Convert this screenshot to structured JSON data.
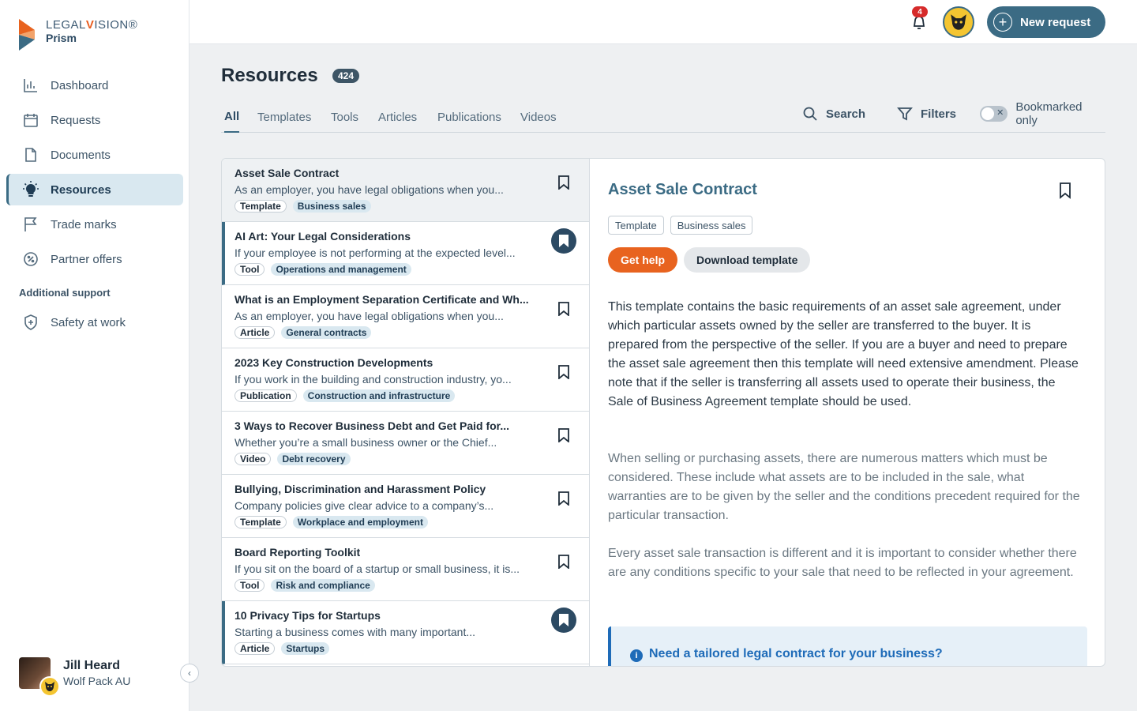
{
  "brand": {
    "name_prefix": "LEGAL",
    "name_highlight": "V",
    "name_suffix": "ISION",
    "product": "Prism"
  },
  "sidebar": {
    "items": [
      {
        "label": "Dashboard",
        "icon": "bar-chart-icon"
      },
      {
        "label": "Requests",
        "icon": "calendar-icon"
      },
      {
        "label": "Documents",
        "icon": "document-icon"
      },
      {
        "label": "Resources",
        "icon": "lightbulb-icon",
        "active": true
      },
      {
        "label": "Trade marks",
        "icon": "flag-icon"
      },
      {
        "label": "Partner offers",
        "icon": "percent-badge-icon"
      }
    ],
    "section_label": "Additional support",
    "support_items": [
      {
        "label": "Safety at work",
        "icon": "shield-plus-icon"
      }
    ],
    "user": {
      "name": "Jill Heard",
      "org": "Wolf Pack AU"
    }
  },
  "topbar": {
    "notification_count": "4",
    "new_request_label": "New request"
  },
  "page": {
    "title": "Resources",
    "count": "424"
  },
  "tabs": [
    "All",
    "Templates",
    "Tools",
    "Articles",
    "Publications",
    "Videos"
  ],
  "toolbar": {
    "search_label": "Search",
    "filters_label": "Filters",
    "bookmarked_label": "Bookmarked only"
  },
  "list": [
    {
      "title": "Asset Sale Contract",
      "desc": "As an employer, you have legal obligations when you...",
      "type": "Template",
      "category": "Business sales",
      "bookmarked": false,
      "selected": true
    },
    {
      "title": "AI Art: Your Legal Considerations",
      "desc": "If your employee is not performing at the expected level...",
      "type": "Tool",
      "category": "Operations and management",
      "bookmarked": true,
      "selected": false
    },
    {
      "title": "What is an Employment Separation Certificate and Wh...",
      "desc": "As an employer, you have legal obligations when you...",
      "type": "Article",
      "category": "General contracts",
      "bookmarked": false,
      "selected": false
    },
    {
      "title": "2023 Key Construction Developments",
      "desc": "If you work in the building and construction industry, yo...",
      "type": "Publication",
      "category": "Construction and infrastructure",
      "bookmarked": false,
      "selected": false
    },
    {
      "title": "3 Ways to Recover Business Debt and Get Paid for...",
      "desc": "Whether you’re a small business owner or the Chief...",
      "type": "Video",
      "category": "Debt recovery",
      "bookmarked": false,
      "selected": false
    },
    {
      "title": "Bullying, Discrimination and Harassment Policy",
      "desc": "Company policies give clear advice to a company’s...",
      "type": "Template",
      "category": "Workplace and employment",
      "bookmarked": false,
      "selected": false
    },
    {
      "title": "Board Reporting Toolkit",
      "desc": "If you sit on the board of a startup or small business, it is...",
      "type": "Tool",
      "category": "Risk and compliance",
      "bookmarked": false,
      "selected": false
    },
    {
      "title": "10 Privacy Tips for Startups",
      "desc": "Starting a business comes with many important...",
      "type": "Article",
      "category": "Startups",
      "bookmarked": true,
      "selected": false
    }
  ],
  "detail": {
    "title": "Asset Sale Contract",
    "chips": [
      "Template",
      "Business sales"
    ],
    "help_label": "Get help",
    "download_label": "Download template",
    "paragraphs": [
      "This template contains the basic requirements of an asset sale agreement, under which particular assets owned by the seller are transferred to the buyer. It is prepared from the perspective of the seller. If you are a buyer and need to prepare the asset sale agreement then this template will need extensive amendment. Please note that if the seller is transferring all assets used to operate their business, the Sale of Business Agreement template should be used.",
      "When selling or purchasing assets, there are numerous matters which must be considered. These include what assets are to be included in the sale, what warranties are to be given by the seller and the conditions precedent required for the particular transaction.",
      "Every asset sale transaction is different and it is important to consider whether there are any conditions specific to your sale that need to be reflected in your agreement."
    ],
    "callout": "Need a tailored legal contract for your business?"
  }
}
